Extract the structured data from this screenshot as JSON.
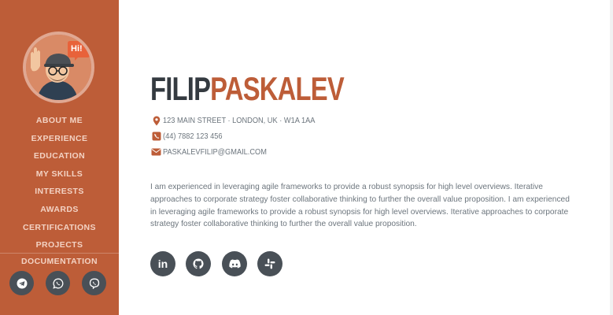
{
  "sidebar": {
    "avatar_badge": "Hi!",
    "nav": [
      {
        "label": "ABOUT ME"
      },
      {
        "label": "EXPERIENCE"
      },
      {
        "label": "EDUCATION"
      },
      {
        "label": "MY SKILLS"
      },
      {
        "label": "INTERESTS"
      },
      {
        "label": "AWARDS"
      },
      {
        "label": "CERTIFICATIONS"
      },
      {
        "label": "PROJECTS"
      },
      {
        "label": "DOCUMENTATION"
      }
    ],
    "socials": [
      {
        "icon": "telegram-icon"
      },
      {
        "icon": "whatsapp-icon"
      },
      {
        "icon": "viber-icon"
      }
    ]
  },
  "profile": {
    "first_name": "FILIP",
    "last_name": "PASKALEV",
    "address": "123 MAIN STREET · LONDON, UK · W1A 1AA",
    "phone": "(44) 7882 123 456",
    "email": "PASKALEVFILIP@GMAIL.COM",
    "bio": "I am experienced in leveraging agile frameworks to provide a robust synopsis for high level overviews. Iterative approaches to corporate strategy foster collaborative thinking to further the overall value proposition. I am experienced in leveraging agile frameworks to provide a robust synopsis for high level overviews. Iterative approaches to corporate strategy foster collaborative thinking to further the overall value proposition.",
    "socials": [
      {
        "icon": "linkedin-icon",
        "text": "in"
      },
      {
        "icon": "github-icon"
      },
      {
        "icon": "discord-icon"
      },
      {
        "icon": "slack-icon"
      }
    ]
  },
  "colors": {
    "primary": "#bd5d38",
    "dark": "#343a40",
    "muted": "#6c757d",
    "social_bg": "#495057"
  }
}
